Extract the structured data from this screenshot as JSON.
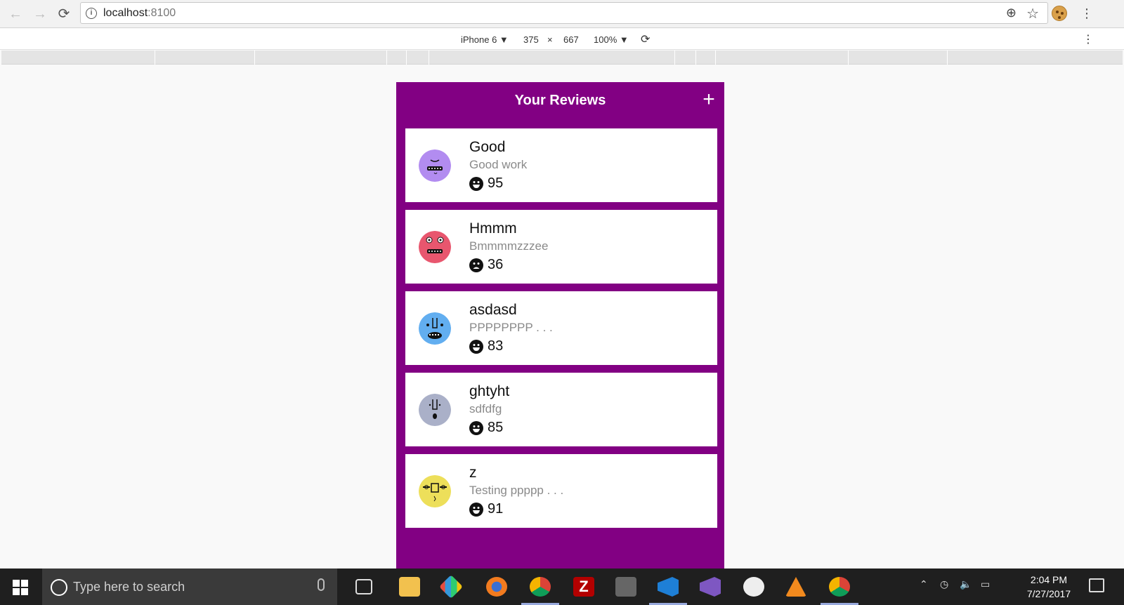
{
  "browser": {
    "url_host": "localhost",
    "url_port": ":8100",
    "device": "iPhone 6 ▼",
    "width": "375",
    "times": "×",
    "height": "667",
    "zoom": "100% ▼"
  },
  "app": {
    "title": "Your Reviews",
    "add_icon": "plus-icon",
    "header_color": "#820083",
    "reviews": [
      {
        "title": "Good",
        "description": "Good work",
        "score": "95",
        "mood": "happy",
        "avatar_color": "#b28cf0"
      },
      {
        "title": "Hmmm",
        "description": "Bmmmmzzzee",
        "score": "36",
        "mood": "sad",
        "avatar_color": "#e8566e"
      },
      {
        "title": "asdasd",
        "description": "PPPPPPPP . . .",
        "score": "83",
        "mood": "happy",
        "avatar_color": "#62aef0"
      },
      {
        "title": "ghtyht",
        "description": "sdfdfg",
        "score": "85",
        "mood": "happy",
        "avatar_color": "#aab0c8"
      },
      {
        "title": "z",
        "description": "Testing ppppp . . .",
        "score": "91",
        "mood": "happy",
        "avatar_color": "#eddf5a"
      }
    ]
  },
  "taskbar": {
    "search_placeholder": "Type here to search",
    "time": "2:04 PM",
    "date": "7/27/2017"
  }
}
